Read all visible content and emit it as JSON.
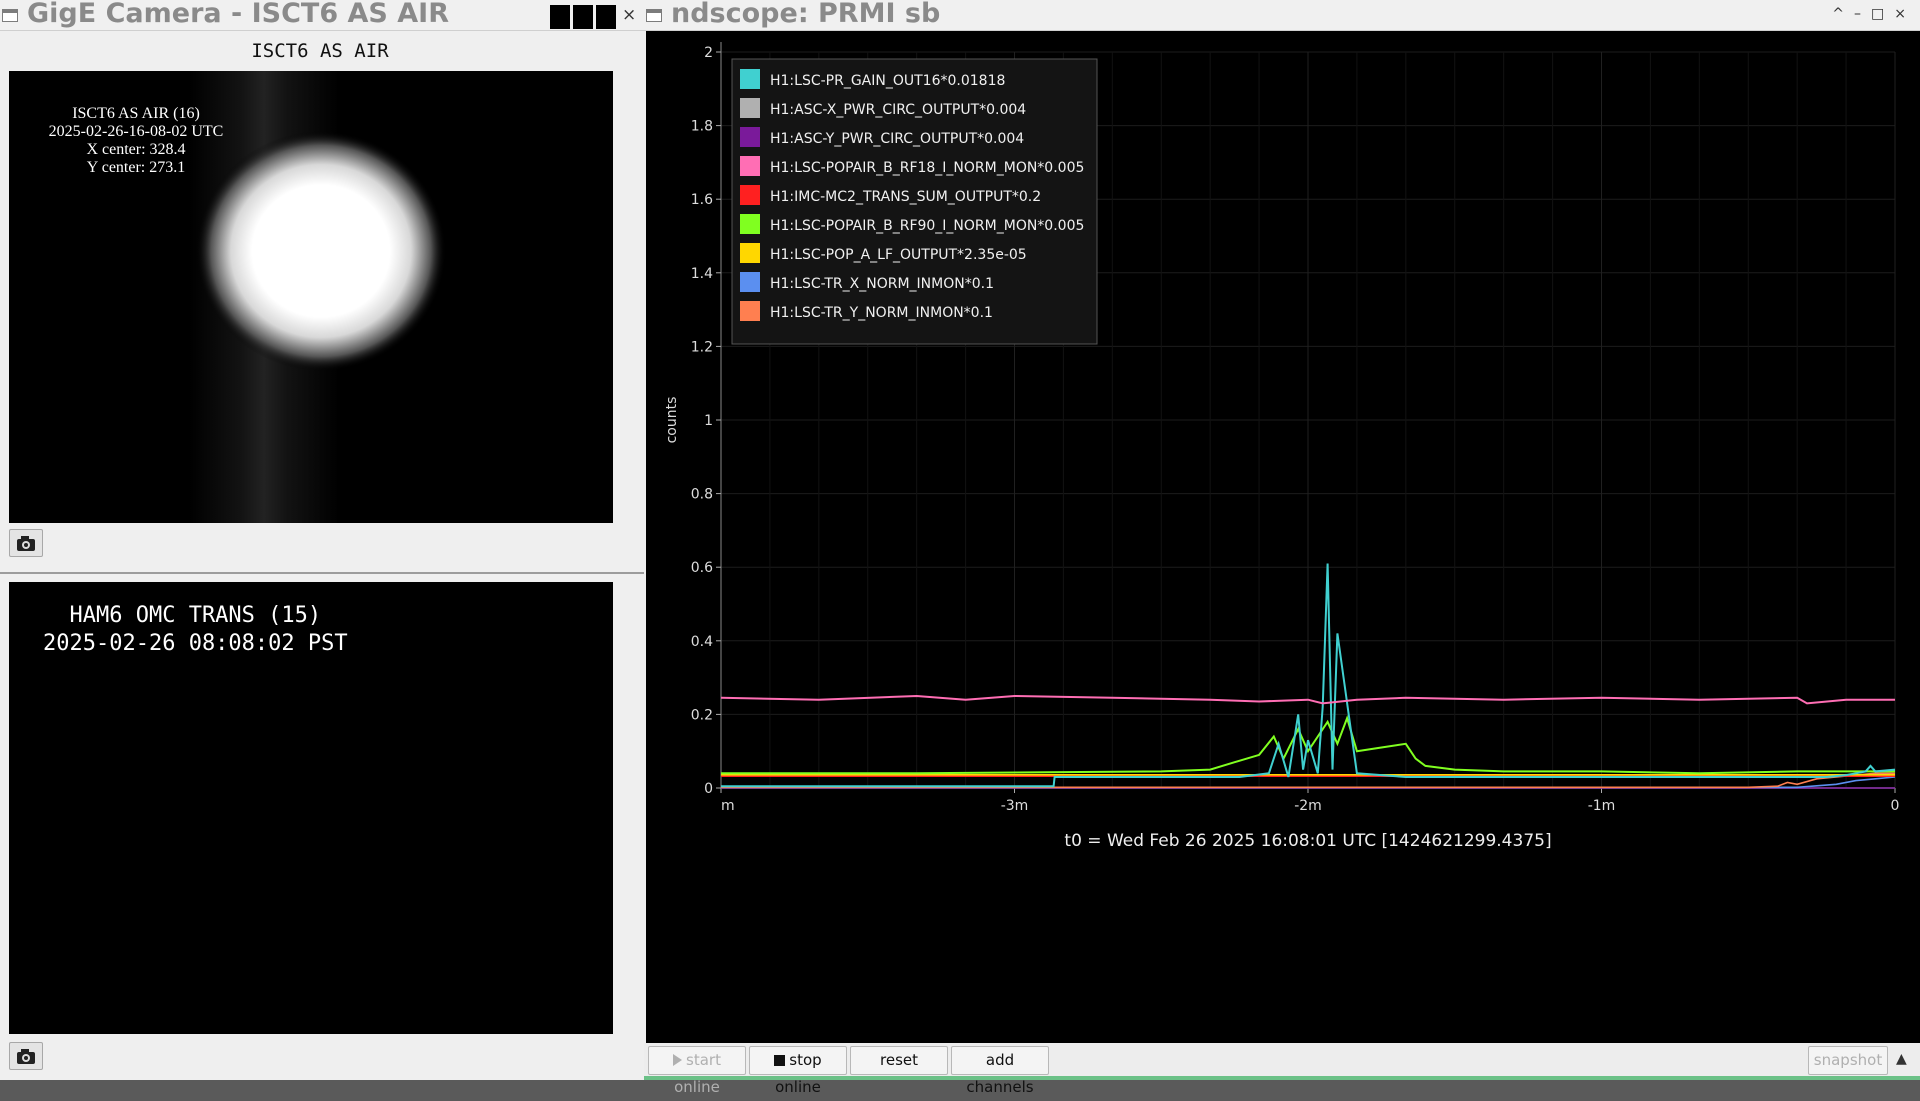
{
  "camera_window": {
    "title": "GigE Camera - ISCT6 AS AIR",
    "close_glyph": "×",
    "header": "ISCT6 AS AIR",
    "view1": {
      "lines": [
        "ISCT6 AS AIR (16)",
        "2025-02-26-16-08-02 UTC",
        "X center: 328.4",
        "Y center: 273.1"
      ],
      "snapshot_icon": "camera-icon"
    },
    "view2": {
      "lines": [
        "  HAM6 OMC TRANS (15)",
        "2025-02-26 08:08:02 PST"
      ],
      "snapshot_icon": "camera-icon"
    }
  },
  "ndscope": {
    "title": "ndscope: PRMI sb",
    "controls": {
      "restore": "^",
      "minimize": "–",
      "maximize": "□",
      "close": "×"
    },
    "t0_label": "t0 = Wed Feb 26 2025 16:08:01 UTC [1424621299.4375]",
    "buttons": {
      "start_online": "start online",
      "stop_online": "stop online",
      "reset": "reset",
      "add_channels": "add channels",
      "snapshot": "snapshot",
      "expand_glyph": "▲"
    }
  },
  "chart_data": {
    "type": "line",
    "ylabel": "counts",
    "xlabel": "",
    "ylim": [
      0,
      2
    ],
    "yticks": [
      {
        "v": 0,
        "label": "0"
      },
      {
        "v": 0.2,
        "label": "0.2"
      },
      {
        "v": 0.4,
        "label": "0.4"
      },
      {
        "v": 0.6,
        "label": "0.6"
      },
      {
        "v": 0.8,
        "label": "0.8"
      },
      {
        "v": 1,
        "label": "1"
      },
      {
        "v": 1.2,
        "label": "1.2"
      },
      {
        "v": 1.4,
        "label": "1.4"
      },
      {
        "v": 1.6,
        "label": "1.6"
      },
      {
        "v": 1.8,
        "label": "1.8"
      },
      {
        "v": 2,
        "label": "2"
      }
    ],
    "xlim": [
      -240,
      0
    ],
    "xticks": [
      {
        "v": -240,
        "label": "m"
      },
      {
        "v": -180,
        "label": "-3m"
      },
      {
        "v": -120,
        "label": "-2m"
      },
      {
        "v": -60,
        "label": "-1m"
      },
      {
        "v": 0,
        "label": "0"
      }
    ],
    "grid": true,
    "legend_position": "top-left",
    "series": [
      {
        "name": "H1:LSC-PR_GAIN_OUT16*0.01818",
        "color": "#40d0d0",
        "x": [
          -240,
          -172,
          -171.8,
          -134,
          -128,
          -126,
          -124,
          -122,
          -121,
          -120,
          -118,
          -117,
          -116,
          -115,
          -114,
          -110,
          -100,
          -90,
          -60,
          -30,
          -14,
          -10,
          -8,
          -6,
          -5,
          -4,
          0
        ],
        "y": [
          0.005,
          0.005,
          0.03,
          0.03,
          0.04,
          0.12,
          0.03,
          0.2,
          0.05,
          0.13,
          0.04,
          0.22,
          0.61,
          0.05,
          0.42,
          0.04,
          0.03,
          0.03,
          0.03,
          0.03,
          0.03,
          0.035,
          0.04,
          0.045,
          0.06,
          0.045,
          0.05
        ]
      },
      {
        "name": "H1:ASC-X_PWR_CIRC_OUTPUT*0.004",
        "color": "#b0b0b0",
        "x": [
          -240,
          0
        ],
        "y": [
          0,
          0
        ]
      },
      {
        "name": "H1:ASC-Y_PWR_CIRC_OUTPUT*0.004",
        "color": "#7a1a9a",
        "x": [
          -240,
          0
        ],
        "y": [
          0,
          0
        ]
      },
      {
        "name": "H1:LSC-POPAIR_B_RF18_I_NORM_MON*0.005",
        "color": "#ff6eb4",
        "x": [
          -240,
          -220,
          -200,
          -190,
          -180,
          -160,
          -140,
          -130,
          -120,
          -117,
          -110,
          -100,
          -80,
          -60,
          -40,
          -20,
          -18,
          -10,
          0
        ],
        "y": [
          0.245,
          0.24,
          0.25,
          0.24,
          0.25,
          0.245,
          0.24,
          0.235,
          0.24,
          0.23,
          0.24,
          0.245,
          0.24,
          0.245,
          0.24,
          0.245,
          0.23,
          0.24,
          0.24
        ]
      },
      {
        "name": "H1:IMC-MC2_TRANS_SUM_OUTPUT*0.2",
        "color": "#ff2020",
        "x": [
          -240,
          0
        ],
        "y": [
          0.032,
          0.032
        ]
      },
      {
        "name": "H1:LSC-POPAIR_B_RF90_I_NORM_MON*0.005",
        "color": "#80ff20",
        "x": [
          -240,
          -200,
          -150,
          -140,
          -135,
          -130,
          -127,
          -125,
          -122,
          -120,
          -118,
          -116,
          -114,
          -112,
          -110,
          -105,
          -100,
          -98,
          -96,
          -90,
          -80,
          -60,
          -40,
          -20,
          0
        ],
        "y": [
          0.04,
          0.04,
          0.045,
          0.05,
          0.07,
          0.09,
          0.14,
          0.08,
          0.16,
          0.1,
          0.14,
          0.18,
          0.12,
          0.19,
          0.1,
          0.11,
          0.12,
          0.08,
          0.06,
          0.05,
          0.045,
          0.045,
          0.04,
          0.045,
          0.045
        ]
      },
      {
        "name": "H1:LSC-POP_A_LF_OUTPUT*2.35e-05",
        "color": "#ffd700",
        "x": [
          -240,
          0
        ],
        "y": [
          0.036,
          0.036
        ]
      },
      {
        "name": "H1:LSC-TR_X_NORM_INMON*0.1",
        "color": "#5b8ff0",
        "x": [
          -240,
          -20,
          -12,
          -8,
          -4,
          0
        ],
        "y": [
          0.002,
          0.002,
          0.01,
          0.02,
          0.025,
          0.03
        ]
      },
      {
        "name": "H1:LSC-TR_Y_NORM_INMON*0.1",
        "color": "#ff7f50",
        "x": [
          -240,
          -30,
          -24,
          -22,
          -20,
          -16,
          -12,
          -8,
          -4,
          0
        ],
        "y": [
          0.002,
          0.002,
          0.005,
          0.015,
          0.01,
          0.025,
          0.03,
          0.035,
          0.04,
          0.04
        ]
      }
    ]
  }
}
